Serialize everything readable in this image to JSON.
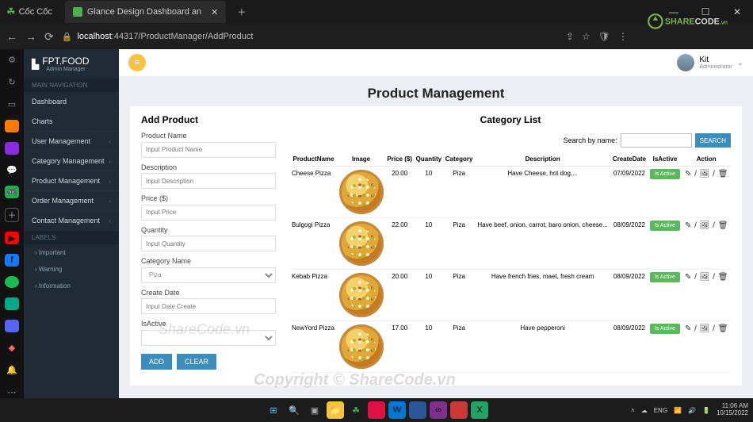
{
  "browser": {
    "app_name": "Cốc Cốc",
    "tab_title": "Glance Design Dashboard an",
    "url_host": "localhost",
    "url_path": ":44317/ProductManager/AddProduct",
    "win_controls": {
      "min": "—",
      "max": "☐",
      "close": "✕"
    }
  },
  "overlay_brand": "SHARECODE.vn",
  "admin": {
    "brand": "FPT.FOOD",
    "brand_sub": "Admin Manager",
    "sections": {
      "main_nav_label": "MAIN NAVIGATION",
      "labels_label": "LABELS"
    },
    "items": [
      "Dashboard",
      "Charts",
      "User Management",
      "Category Management",
      "Product Management",
      "Order Management",
      "Contact Management"
    ],
    "labels": [
      "Important",
      "Warning",
      "Information"
    ]
  },
  "top": {
    "user_name": "Kit",
    "user_role": "Administrator"
  },
  "page_title": "Product Management",
  "form": {
    "heading": "Add Product",
    "fields": {
      "product_name": {
        "label": "Product Name",
        "placeholder": "Input Product Name"
      },
      "description": {
        "label": "Description",
        "placeholder": "Input Description"
      },
      "price": {
        "label": "Price ($)",
        "placeholder": "Input Price"
      },
      "quantity": {
        "label": "Quantity",
        "placeholder": "Input Quantity"
      },
      "category": {
        "label": "Category Name",
        "value": "Piza"
      },
      "create_date": {
        "label": "Create Date",
        "placeholder": "Input Date Create"
      },
      "is_active": {
        "label": "IsActive"
      }
    },
    "buttons": {
      "add": "ADD",
      "clear": "CLEAR"
    }
  },
  "table": {
    "heading": "Category List",
    "search_label": "Search by name:",
    "search_btn": "SEARCH",
    "headers": [
      "ProductName",
      "Image",
      "Price ($)",
      "Quantity",
      "Category",
      "Description",
      "CreateDate",
      "IsActive",
      "Action"
    ],
    "rows": [
      {
        "name": "Cheese Pizza",
        "price": "20.00",
        "qty": "10",
        "cat": "Piza",
        "desc": "Have Cheese, hot dog,...",
        "date": "07/09/2022",
        "active": "Is Active"
      },
      {
        "name": "Bulgogi Pizza",
        "price": "22.00",
        "qty": "10",
        "cat": "Piza",
        "desc": "Have beef, onion, carrot, baro onion, cheese...",
        "date": "08/09/2022",
        "active": "Is Active"
      },
      {
        "name": "Kebab Pizza",
        "price": "20.00",
        "qty": "10",
        "cat": "Piza",
        "desc": "Have french fries, maet, fresh cream",
        "date": "08/09/2022",
        "active": "Is Active"
      },
      {
        "name": "NewYord Pizza",
        "price": "17.00",
        "qty": "10",
        "cat": "Piza",
        "desc": "Have pepperoni",
        "date": "08/09/2022",
        "active": "Is Active"
      }
    ]
  },
  "watermarks": {
    "wm1": "Copyright © ShareCode.vn",
    "wm2": "ShareCode.vn"
  },
  "taskbar": {
    "lang": "ENG",
    "time": "11:06 AM",
    "date": "10/15/2022"
  }
}
